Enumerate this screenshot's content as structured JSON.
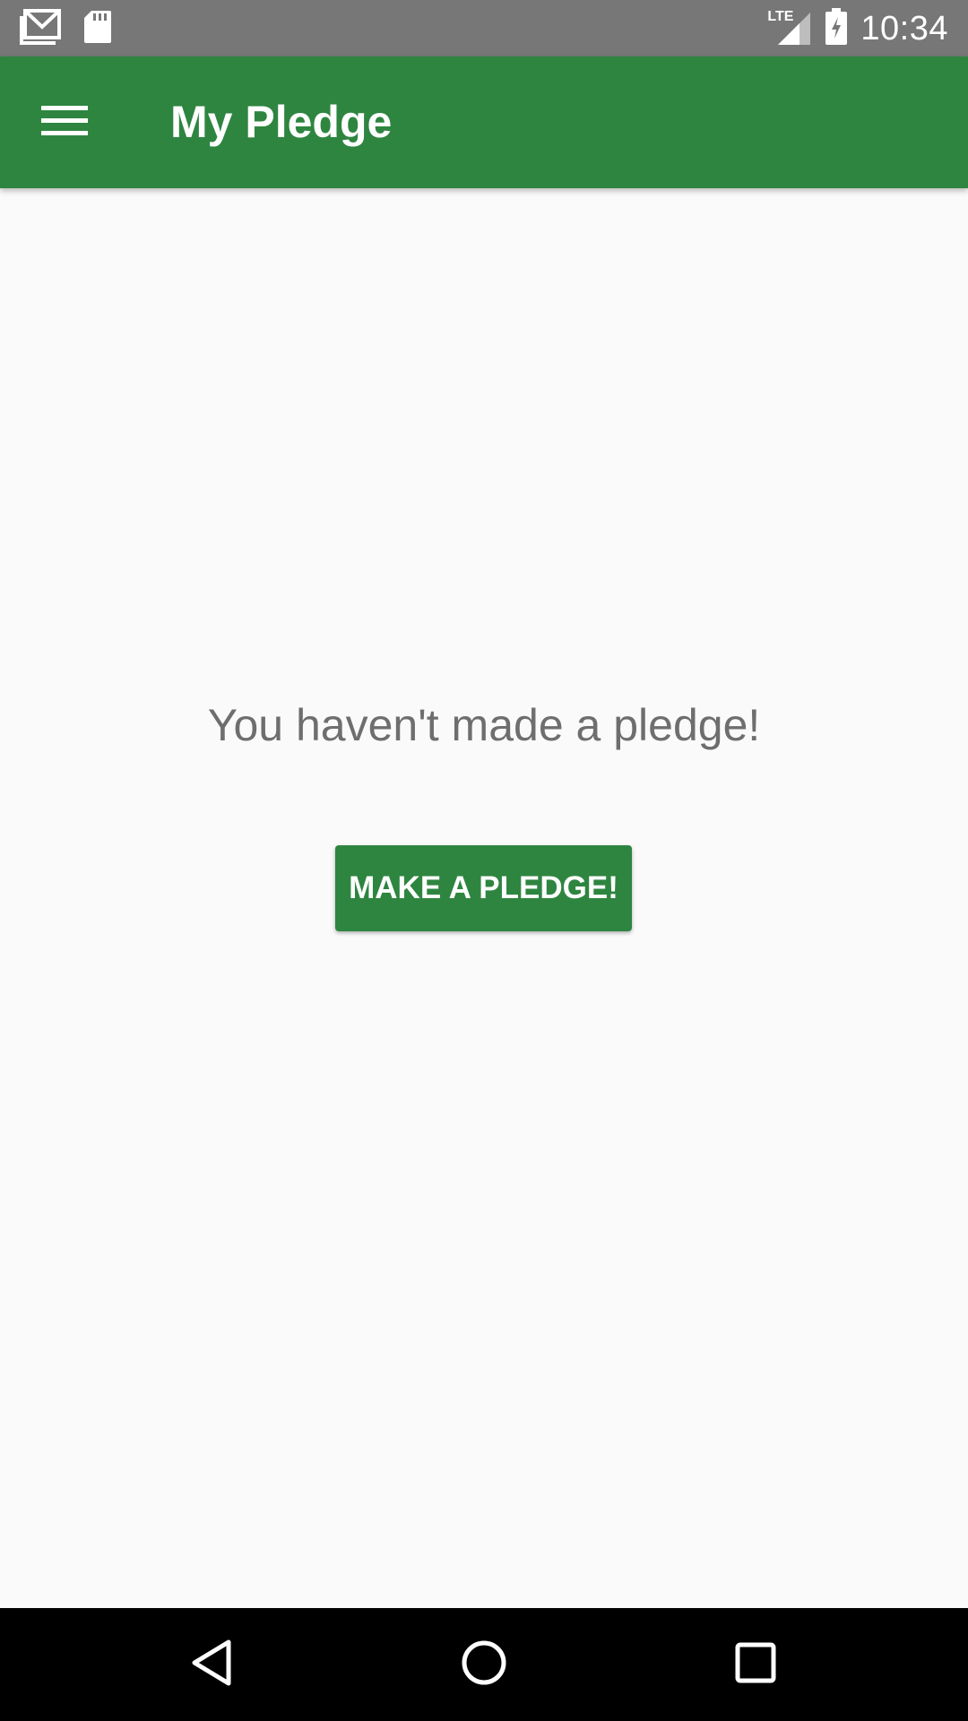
{
  "status_bar": {
    "time": "10:34",
    "network_label": "LTE",
    "icons": [
      "gmail-icon",
      "sd-card-icon",
      "lte-signal-icon",
      "battery-charging-icon"
    ]
  },
  "app_bar": {
    "title": "My Pledge",
    "menu_icon": "menu-icon",
    "background_color": "#2e8540"
  },
  "content": {
    "empty_message": "You haven't made a pledge!",
    "cta_label": "MAKE A PLEDGE!"
  },
  "nav_bar": {
    "icons": [
      "back-icon",
      "home-icon",
      "recents-icon"
    ]
  },
  "colors": {
    "accent": "#2e8540",
    "status_bar": "#777777",
    "background": "#fafafa",
    "message_text": "#6e6e6e"
  }
}
